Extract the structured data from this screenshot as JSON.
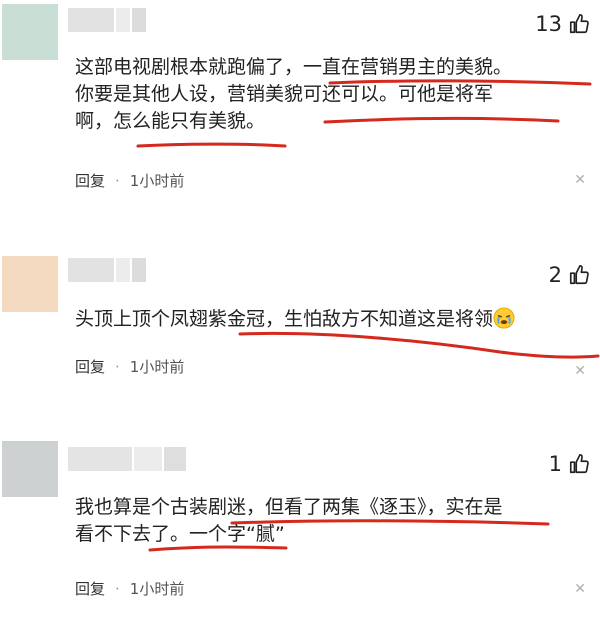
{
  "comments": [
    {
      "avatar_color": "#c9dfd6",
      "likes": "13",
      "lines": [
        "这部电视剧根本就跑偏了，一直在营销男主的美貌。",
        "你要是其他人设，营销美貌可还可以。可他是将军",
        "啊，怎么能只有美貌。"
      ],
      "reply_label": "回复",
      "separator": "·",
      "time": "1小时前",
      "more_icon": "close-icon"
    },
    {
      "avatar_color": "#f2d9bf",
      "likes": "2",
      "lines": [
        "头顶上顶个凤翅紫金冠，生怕敌方不知道这是将领"
      ],
      "emoji": "crying-emoji",
      "reply_label": "回复",
      "separator": "·",
      "time": "1小时前",
      "more_icon": "close-icon"
    },
    {
      "avatar_color": "#cdd1d2",
      "likes": "1",
      "lines": [
        "我也算是个古装剧迷，但看了两集《逐玉》，实在是",
        "看不下去了。一个字“腻”"
      ],
      "reply_label": "回复",
      "separator": "·",
      "time": "1小时前",
      "more_icon": "close-icon"
    }
  ],
  "colors": {
    "underline": "#d42a1e",
    "text": "#222222",
    "meta": "#555555"
  }
}
